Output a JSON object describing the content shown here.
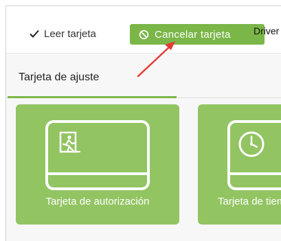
{
  "toolbar": {
    "read_card_label": "Leer tarjeta",
    "cancel_card_label": "Cancelar tarjeta",
    "driver_label": "Driver"
  },
  "tabs": [
    {
      "label": "Tarjeta de ajuste",
      "active": true
    }
  ],
  "cards": [
    {
      "label": "Tarjeta de autorización",
      "icon": "emergency-exit-icon"
    },
    {
      "label": "Tarjeta de tiempo",
      "icon": "clock-icon"
    }
  ],
  "colors": {
    "accent": "#7ab648",
    "card_bg": "#92c462",
    "annotation_arrow": "#e53935"
  }
}
